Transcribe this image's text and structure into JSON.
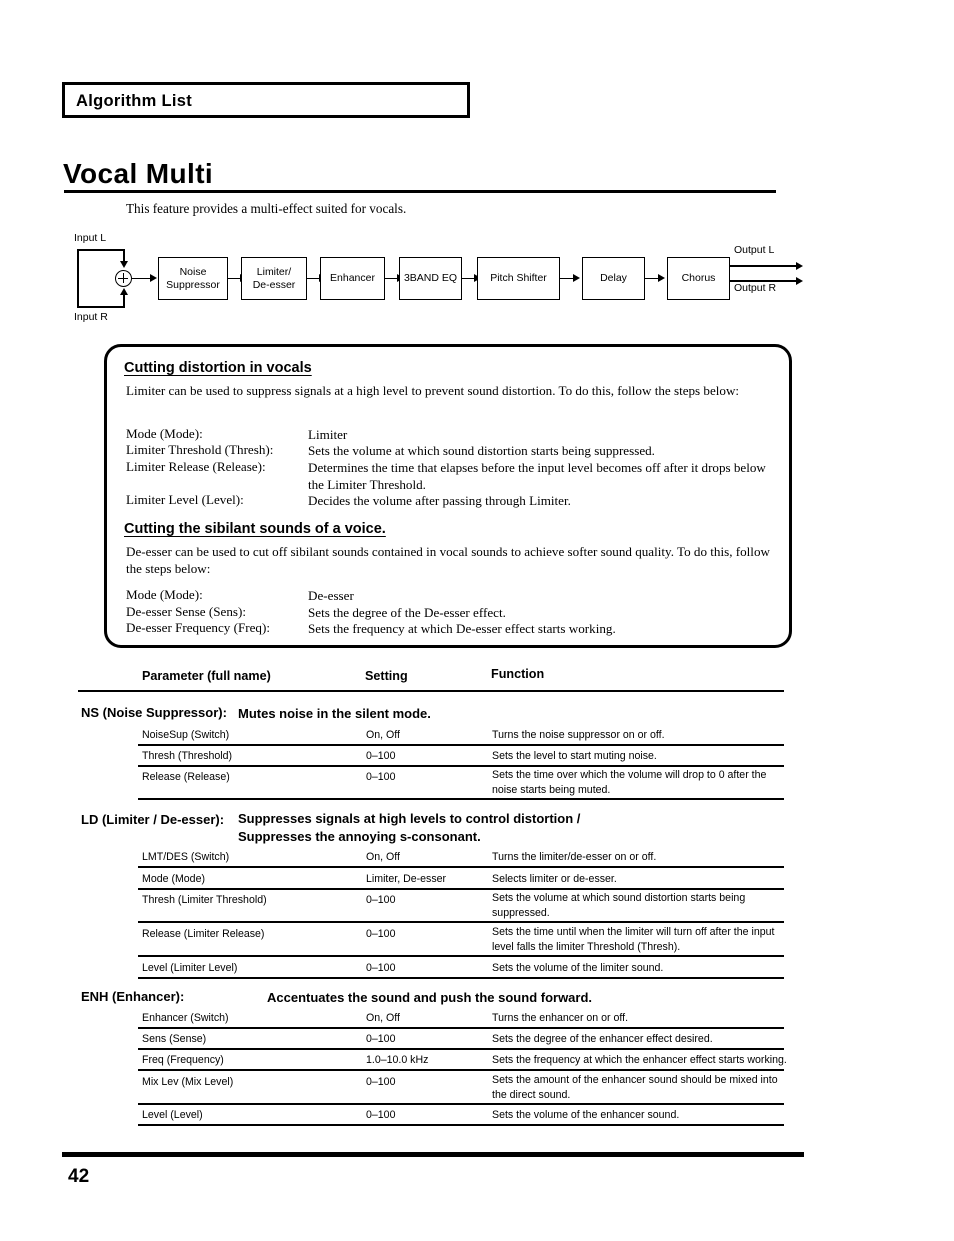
{
  "running_head": {
    "label": "Algorithm List"
  },
  "title": "Vocal Multi",
  "intro": "This feature provides a multi-effect suited for vocals.",
  "diagram": {
    "input_l": "Input L",
    "input_r": "Input R",
    "output_l": "Output L",
    "output_r": "Output R",
    "sum_node": "+",
    "blocks": [
      {
        "label": "Noise\nSuppressor"
      },
      {
        "label": "Limiter/\nDe-esser"
      },
      {
        "label": "Enhancer"
      },
      {
        "label": "3BAND EQ"
      },
      {
        "label": "Pitch Shifter"
      },
      {
        "label": "Delay"
      },
      {
        "label": "Chorus"
      }
    ]
  },
  "callout": {
    "section1": {
      "heading": "Cutting distortion in vocals",
      "intro": "Limiter can be used to suppress signals at a high level to prevent sound distortion. To do this, follow the steps below:",
      "rows": [
        {
          "term": "Mode (Mode):",
          "desc": "Limiter"
        },
        {
          "term": "Limiter Threshold (Thresh):",
          "desc": "Sets the volume at which sound distortion starts being suppressed."
        },
        {
          "term": "Limiter Release (Release):",
          "desc": "Determines the time that elapses before the input level becomes off after it drops below the Limiter Threshold."
        },
        {
          "term": "Limiter Level (Level):",
          "desc": "Decides the volume after passing through Limiter."
        }
      ]
    },
    "section2": {
      "heading": "Cutting the sibilant sounds of a voice.",
      "intro": "De-esser can be used to cut off sibilant sounds contained in vocal sounds to achieve softer sound quality. To do this, follow the steps below:",
      "rows": [
        {
          "term": "Mode (Mode):",
          "desc": "De-esser"
        },
        {
          "term": "De-esser Sense (Sens):",
          "desc": "Sets the degree of the De-esser effect."
        },
        {
          "term": "De-esser Frequency (Freq):",
          "desc": "Sets the frequency at which De-esser effect starts working."
        }
      ]
    }
  },
  "table": {
    "headers": {
      "parameter": "Parameter (full name)",
      "setting": "Setting",
      "function": "Function"
    },
    "groups": [
      {
        "name": "NS (Noise Suppressor):",
        "description": "Mutes noise in the silent mode.",
        "rows": [
          {
            "parameter": "NoiseSup (Switch)",
            "setting": "On, Off",
            "function": "Turns the noise suppressor on or off."
          },
          {
            "parameter": "Thresh (Threshold)",
            "setting": "0–100",
            "function": "Sets the level to start muting noise."
          },
          {
            "parameter": "Release (Release)",
            "setting": "0–100",
            "function": "Sets the time over which the volume will drop to 0 after the noise starts being muted."
          }
        ]
      },
      {
        "name": "LD (Limiter / De-esser):",
        "description": "Suppresses signals at high levels to control distortion /\nSuppresses the annoying s-consonant.",
        "rows": [
          {
            "parameter": "LMT/DES (Switch)",
            "setting": "On, Off",
            "function": "Turns the limiter/de-esser on or off."
          },
          {
            "parameter": "Mode (Mode)",
            "setting": "Limiter, De-esser",
            "function": "Selects limiter or de-esser."
          },
          {
            "parameter": "Thresh (Limiter Threshold)",
            "setting": "0–100",
            "function": "Sets the volume at which sound distortion starts being suppressed."
          },
          {
            "parameter": "Release (Limiter Release)",
            "setting": "0–100",
            "function": "Sets the time until when the limiter will turn off after the input level falls the limiter Threshold (Thresh)."
          },
          {
            "parameter": "Level (Limiter Level)",
            "setting": "0–100",
            "function": "Sets the volume of the limiter sound."
          }
        ]
      },
      {
        "name": "ENH (Enhancer):",
        "description": "Accentuates the sound and push the sound forward.",
        "rows": [
          {
            "parameter": "Enhancer (Switch)",
            "setting": "On, Off",
            "function": "Turns the enhancer on or off."
          },
          {
            "parameter": "Sens (Sense)",
            "setting": "0–100",
            "function": "Sets the degree of the enhancer effect desired."
          },
          {
            "parameter": "Freq (Frequency)",
            "setting": "1.0–10.0 kHz",
            "function": "Sets the frequency at which the enhancer effect starts working."
          },
          {
            "parameter": "Mix Lev (Mix Level)",
            "setting": "0–100",
            "function": "Sets the amount of the enhancer sound should be mixed into the direct sound."
          },
          {
            "parameter": "Level (Level)",
            "setting": "0–100",
            "function": "Sets the volume of the enhancer sound."
          }
        ]
      }
    ]
  },
  "footer": {
    "page_number": "42"
  }
}
